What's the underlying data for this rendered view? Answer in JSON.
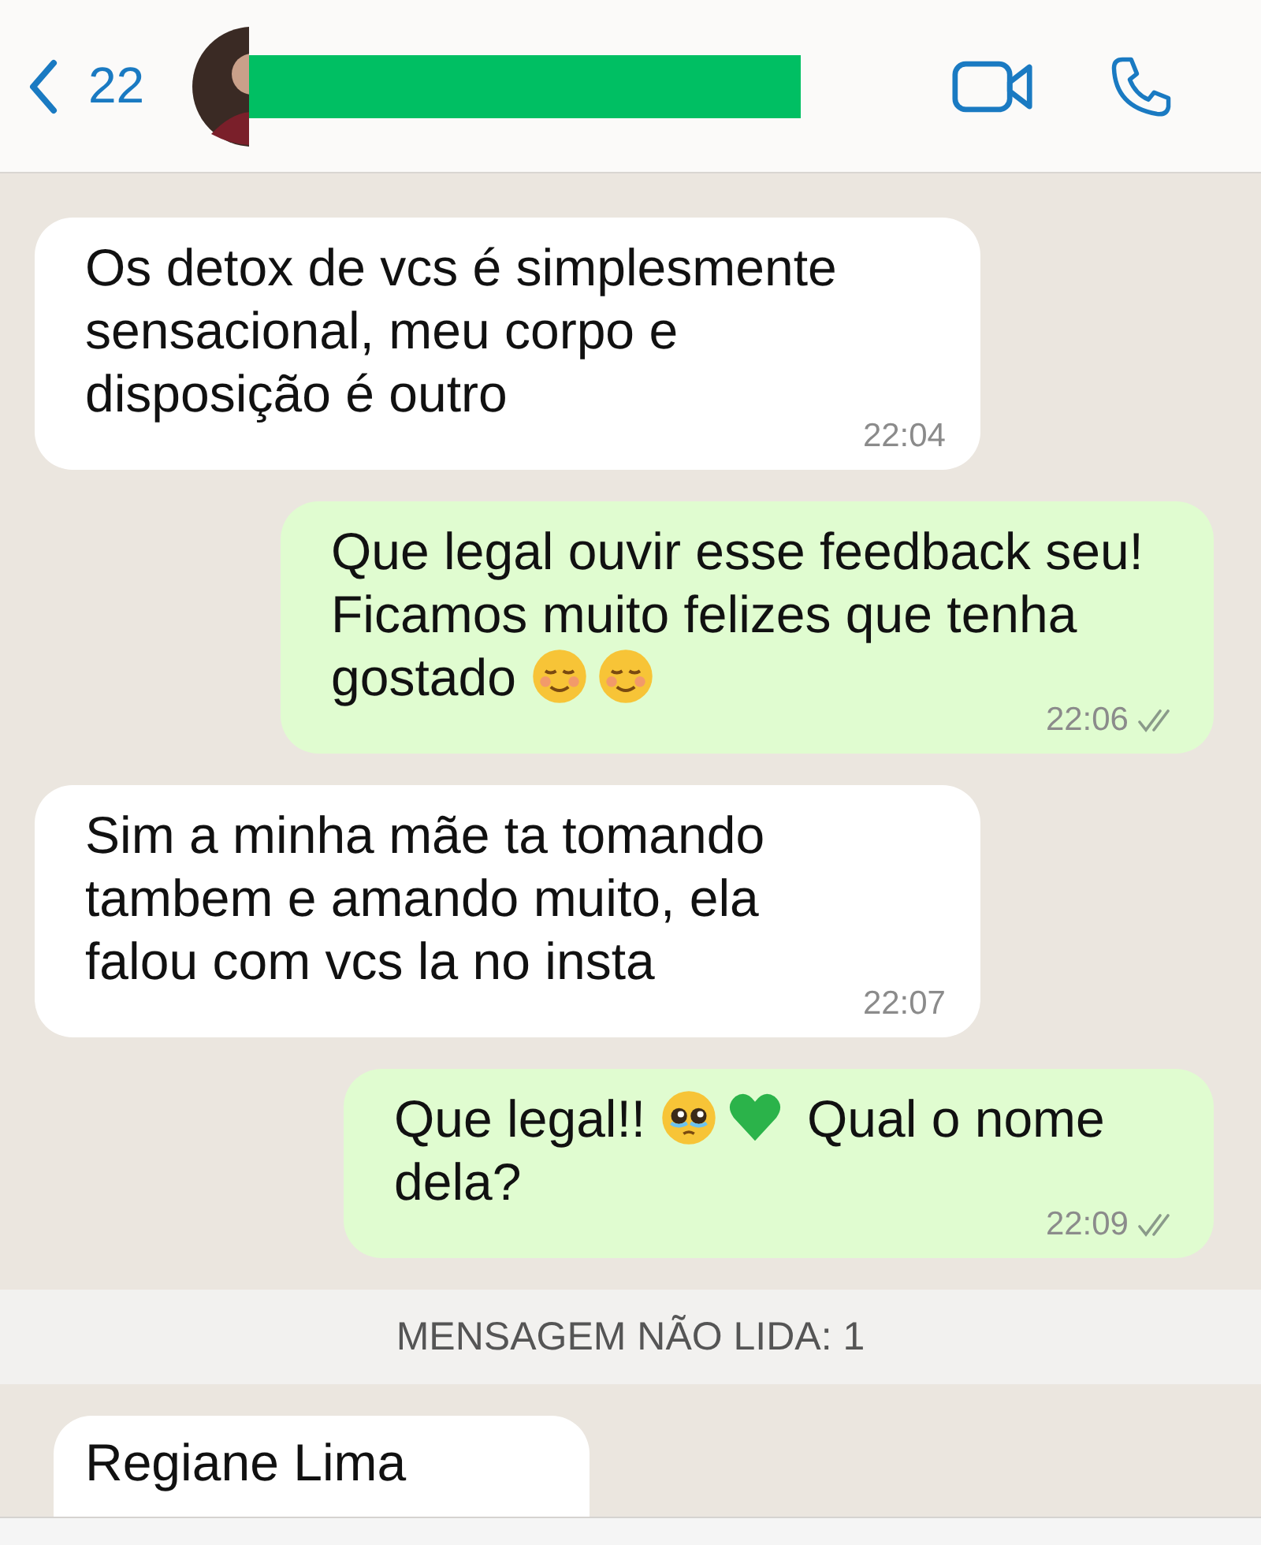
{
  "header": {
    "back_count": "22"
  },
  "messages": [
    {
      "kind": "received",
      "parts": [
        {
          "kind": "text",
          "text": "Os detox de vcs é simplesmente sensacional, meu corpo e disposição é outro"
        }
      ],
      "time": "22:04"
    },
    {
      "kind": "sent",
      "parts": [
        {
          "kind": "text",
          "text": "Que legal ouvir esse feedback seu! Ficamos muito felizes que tenha gostado "
        },
        {
          "kind": "smile"
        },
        {
          "kind": "smile"
        }
      ],
      "time": "22:06",
      "read": false
    },
    {
      "kind": "received",
      "parts": [
        {
          "kind": "text",
          "text": "Sim a minha mãe ta tomando tambem e amando muito, ela falou com vcs la no insta"
        }
      ],
      "time": "22:07"
    },
    {
      "kind": "sent",
      "parts": [
        {
          "kind": "text",
          "text": "Que legal!! "
        },
        {
          "kind": "pleading"
        },
        {
          "kind": "heart"
        },
        {
          "kind": "text",
          "text": " Qual o nome dela?"
        }
      ],
      "time": "22:09",
      "read": false
    }
  ],
  "unread_banner": "MENSAGEM NÃO LIDA: 1",
  "last_message": {
    "text": "Regiane Lima"
  }
}
